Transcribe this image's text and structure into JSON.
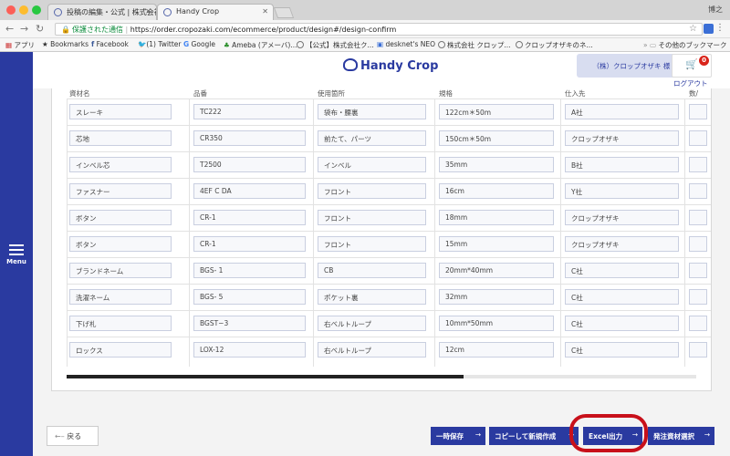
{
  "browser": {
    "tabs": [
      {
        "title": "投稿の編集・公式 | 株式会社ク..."
      },
      {
        "title": "Handy Crop"
      }
    ],
    "profile": "博之",
    "url_secure_label": "保護された通信",
    "url": "https://order.cropozaki.com/ecommerce/product/design#/design-confirm",
    "bookmarks": [
      "アプリ",
      "Bookmarks",
      "Facebook",
      "(1) Twitter",
      "Google",
      "Ameba (アメーバ)...",
      "【公式】株式会社ク...",
      "desknet's NEO",
      "株式会社 クロップ...",
      "クロップオザキのネ...",
      "その他のブックマーク"
    ]
  },
  "sidebar": {
    "menu_label": "Menu"
  },
  "header": {
    "logo": "Handy Crop",
    "user": "（株）クロップオザキ 様",
    "cart_count": "0",
    "logout": "ログアウト"
  },
  "table": {
    "headers": [
      "資材名",
      "品番",
      "使用箇所",
      "規格",
      "仕入先",
      "数/"
    ],
    "rows": [
      [
        "スレーキ",
        "TC222",
        "袋布・腰裏",
        "122cm＊50m",
        "A社"
      ],
      [
        "芯地",
        "CR350",
        "前たて、パーツ",
        "150cm＊50m",
        "クロップオザキ"
      ],
      [
        "インベル芯",
        "T2500",
        "インベル",
        "35mm",
        "B社"
      ],
      [
        "ファスナー",
        "4EF C DA",
        "フロント",
        "16cm",
        "Y社"
      ],
      [
        "ボタン",
        "CR-1",
        "フロント",
        "18mm",
        "クロップオザキ"
      ],
      [
        "ボタン",
        "CR-1",
        "フロント",
        "15mm",
        "クロップオザキ"
      ],
      [
        "ブランドネーム",
        "BGS- 1",
        "CB",
        "20mm*40mm",
        "C社"
      ],
      [
        "洗濯ネーム",
        "BGS- 5",
        "ポケット裏",
        "32mm",
        "C社"
      ],
      [
        "下げ札",
        "BGST−3",
        "右ベルトループ",
        "10mm*50mm",
        "C社"
      ],
      [
        "ロックス",
        "LOX-12",
        "右ベルトループ",
        "12cm",
        "C社"
      ]
    ],
    "scroll_fraction": 0.63
  },
  "footer": {
    "back": "戻る",
    "buttons": [
      "一時保存",
      "コピーして新規作成",
      "Excel出力",
      "発注資材選択"
    ]
  },
  "colors": {
    "brand": "#2a3aa0",
    "highlight": "#c8101a",
    "badge": "#d9241a"
  }
}
